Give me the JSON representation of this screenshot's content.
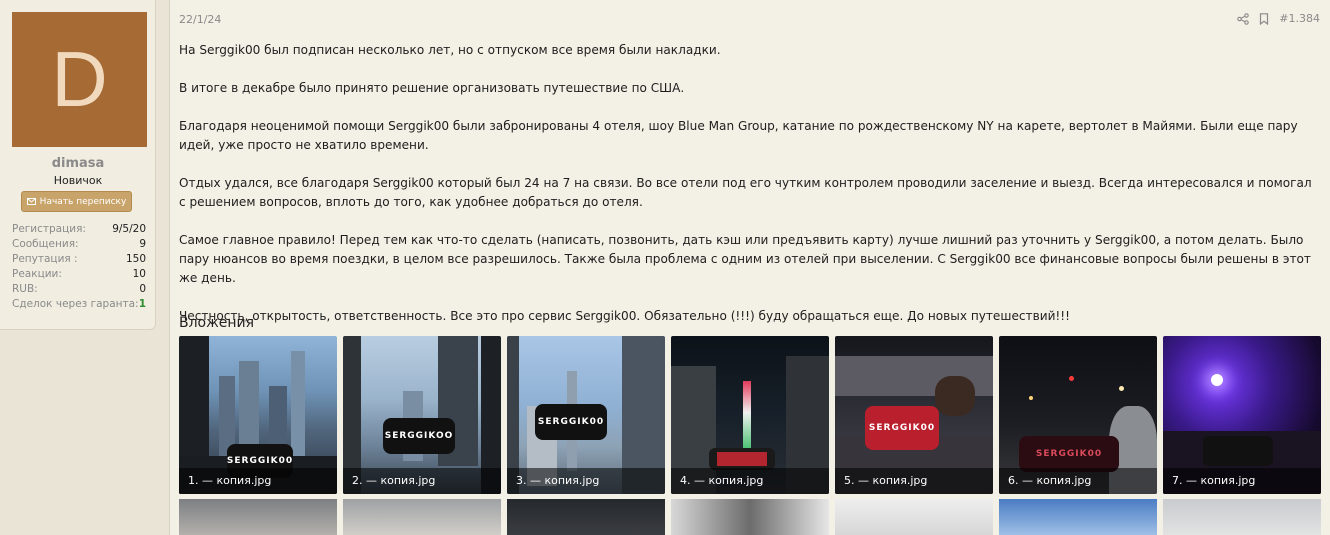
{
  "user": {
    "avatar_letter": "D",
    "username": "dimasa",
    "title": "Новичок",
    "start_conversation_label": "Начать переписку",
    "stats": [
      {
        "label": "Регистрация:",
        "value": "9/5/20"
      },
      {
        "label": "Сообщения:",
        "value": "9"
      },
      {
        "label": "Репутация :",
        "value": "150"
      },
      {
        "label": "Реакции:",
        "value": "10"
      },
      {
        "label": "RUB:",
        "value": "0"
      },
      {
        "label": "Сделок через гаранта:",
        "value": "1"
      }
    ]
  },
  "post": {
    "date": "22/1/24",
    "number": "#1.384",
    "paragraphs": [
      "На Serggik00 был подписан несколько лет, но с отпуском все время были накладки.",
      "В итоге в декабре было принято решение организовать путешествие по США.",
      "Благодаря неоценимой помощи Serggik00 были забронированы 4 отеля, шоу Blue Man Group, катание по рождественскому NY на карете, вертолет в Майями. Были еще пару идей, уже просто не хватило времени.",
      "Отдых удался, все благодаря Serggik00 который был 24 на 7 на связи. Во все отели под его чутким контролем проводили заселение и выезд. Всегда интересовался и помогал с решением вопросов, вплоть до того, как удобнее добраться до отеля.",
      "Самое главное правило! Перед тем как что-то сделать (написать, позвонить, дать кэш или предъявить карту) лучше лишний раз уточнить у Serggik00, а потом делать. Было пару нюансов во время поездки, в целом все разрешилось. Также была проблема с одним из отелей при выселении. С Serggik00 все финансовые вопросы были решены в этот же день.",
      "Честность, открытость, ответственность. Все это про сервис Serggik00. Обязательно (!!!) буду обращаться еще. До новых путешествий!!!"
    ],
    "attachments_title": "Вложения",
    "attachments": [
      {
        "caption": "1. — копия.jpg",
        "phone_text": "SERGGIK00"
      },
      {
        "caption": "2. — копия.jpg",
        "phone_text": "SERGGIKOO"
      },
      {
        "caption": "3. — копия.jpg",
        "phone_text": "SERGGIK00"
      },
      {
        "caption": "4. — копия.jpg",
        "phone_text": ""
      },
      {
        "caption": "5. — копия.jpg",
        "phone_text": "SERGGIK00"
      },
      {
        "caption": "6. — копия.jpg",
        "phone_text": "SERGGIK00"
      },
      {
        "caption": "7. — копия.jpg",
        "phone_text": ""
      }
    ]
  },
  "colors": {
    "page_bg": "#e9e4d6",
    "panel_bg": "#f3f0e5",
    "avatar_bg": "#a66a34",
    "button_bg": "#c9a46a",
    "green": "#2f8c2f"
  }
}
